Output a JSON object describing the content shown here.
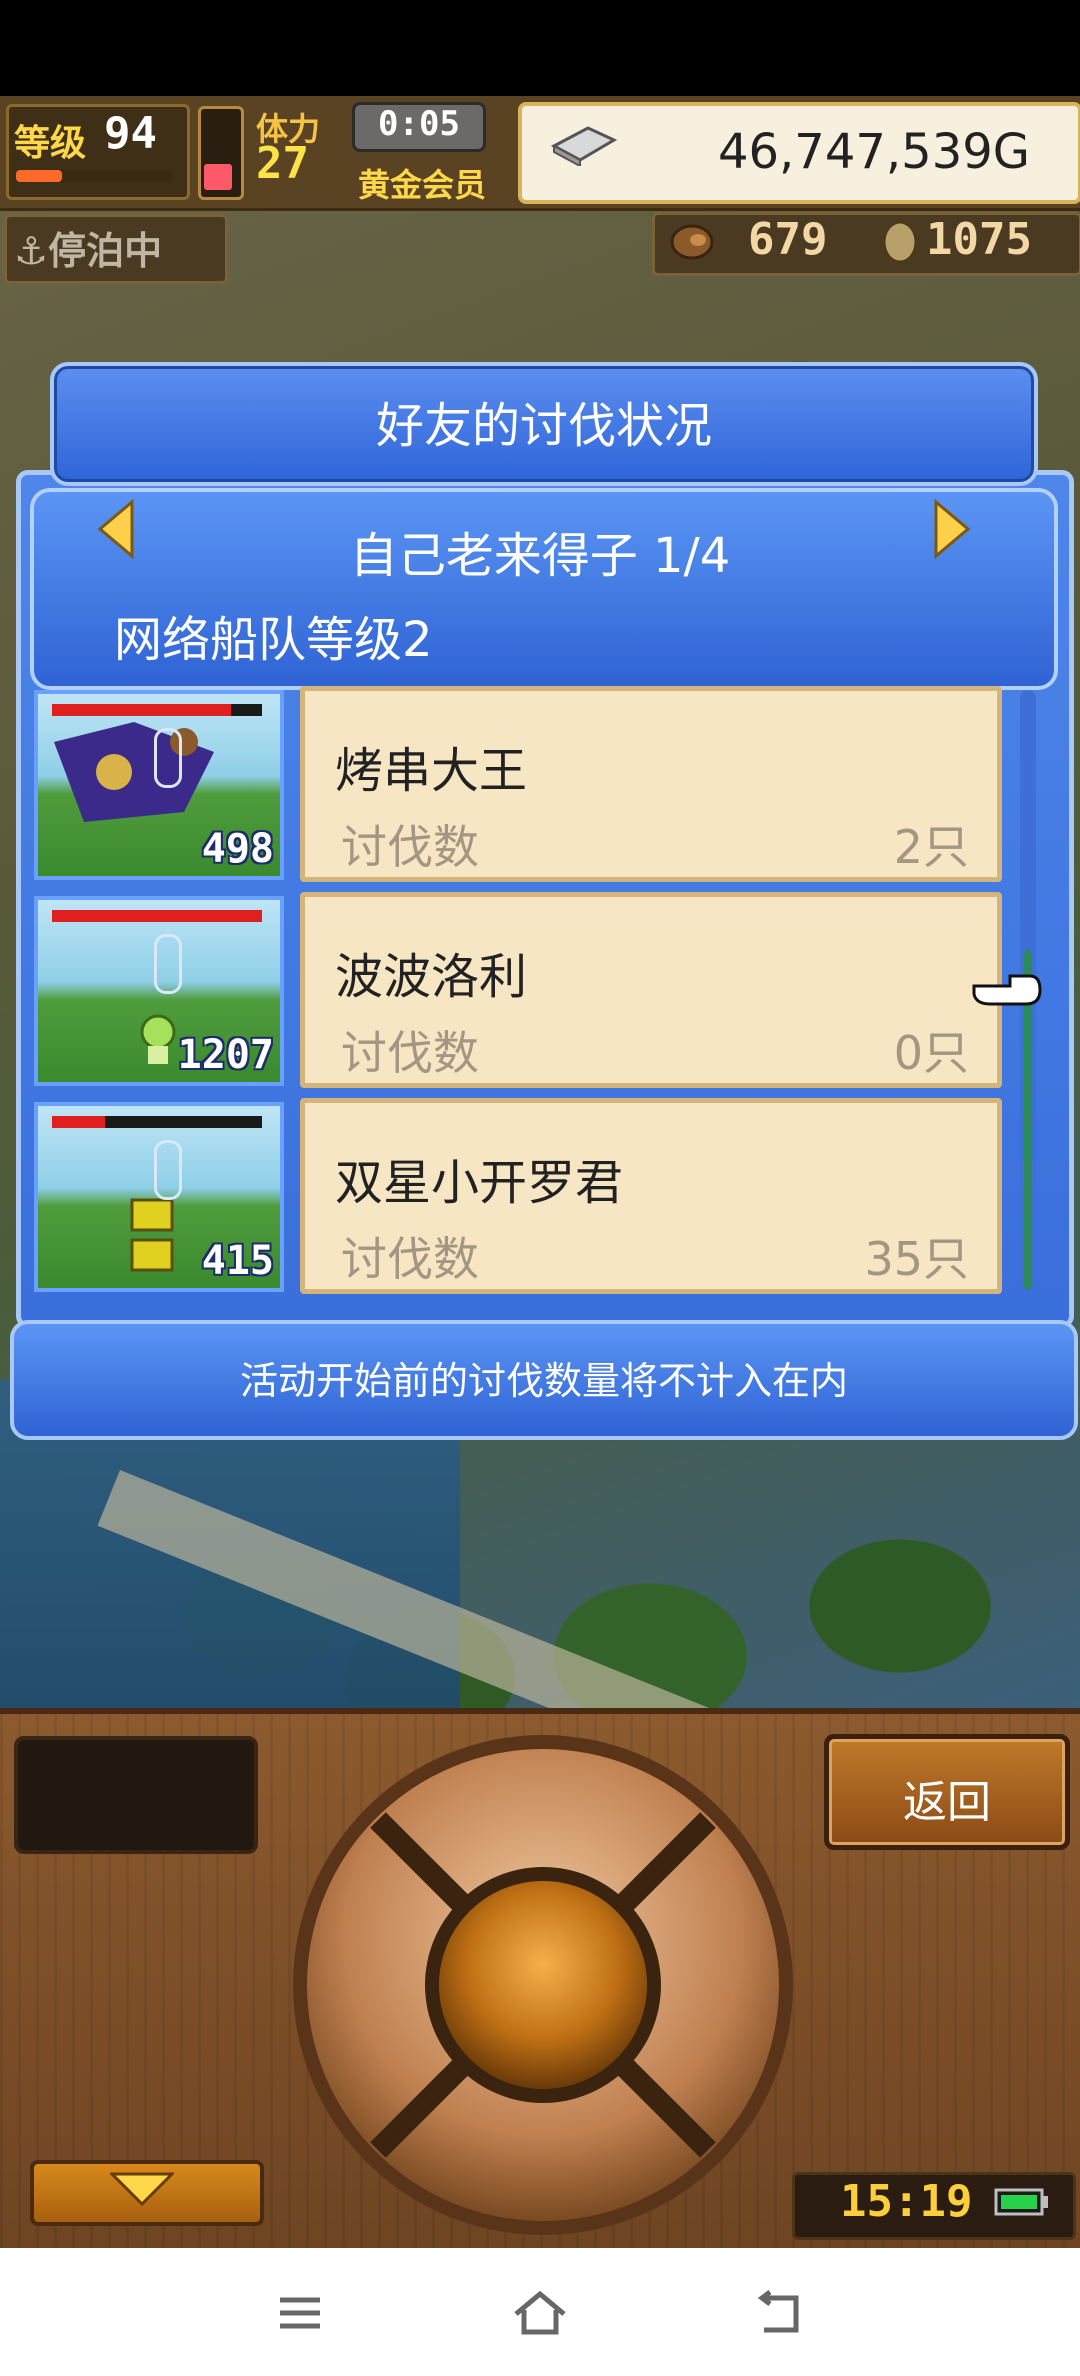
{
  "hud": {
    "level_label": "等级",
    "level_value": "94",
    "stamina_label": "体力",
    "stamina_value": "27",
    "timer": "0:05",
    "membership": "黄金会员",
    "money": "46,747,539G",
    "dock_status": "停泊中",
    "resource1_value": "679",
    "resource2_value": "1075"
  },
  "dialog": {
    "title": "好友的讨伐状况",
    "fleet_name": "自己老来得子 1/4",
    "fleet_level": "网络船队等级2",
    "rows": [
      {
        "name": "烤串大王",
        "label": "讨伐数",
        "count": "2只",
        "thumb_number": "498",
        "hp_fraction": 0.85
      },
      {
        "name": "波波洛利",
        "label": "讨伐数",
        "count": "0只",
        "thumb_number": "1207",
        "hp_fraction": 1.0
      },
      {
        "name": "双星小开罗君",
        "label": "讨伐数",
        "count": "35只",
        "thumb_number": "415",
        "hp_fraction": 0.25
      }
    ],
    "footer_note": "活动开始前的讨伐数量将不计入在内"
  },
  "console": {
    "back_label": "返回",
    "clock": "15:19"
  },
  "colors": {
    "panel_blue": "#3a6fdc",
    "card_bg": "#f6e6c4",
    "gold_text": "#ffd84a",
    "hp_red": "#e01f1f"
  },
  "icons": {
    "money": "silver-bar-icon",
    "resource1": "ore-icon",
    "resource2": "coin-icon",
    "dock": "anchor-icon",
    "nav_left": "menu-icon",
    "nav_center": "home-icon",
    "nav_right": "back-icon"
  }
}
